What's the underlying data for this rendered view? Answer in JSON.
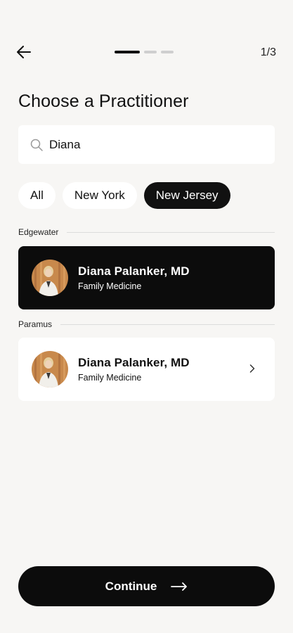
{
  "header": {
    "step_counter": "1/3",
    "progress": {
      "current_step": 1,
      "total_steps": 3
    }
  },
  "page_title": "Choose a Practitioner",
  "search": {
    "value": "Diana",
    "placeholder": ""
  },
  "filters": [
    {
      "label": "All",
      "selected": false
    },
    {
      "label": "New York",
      "selected": false
    },
    {
      "label": "New Jersey",
      "selected": true
    }
  ],
  "sections": [
    {
      "location": "Edgewater",
      "practitioners": [
        {
          "name": "Diana Palanker, MD",
          "specialty": "Family Medicine",
          "selected": true
        }
      ]
    },
    {
      "location": "Paramus",
      "practitioners": [
        {
          "name": "Diana Palanker, MD",
          "specialty": "Family Medicine",
          "selected": false
        }
      ]
    }
  ],
  "continue_button": {
    "label": "Continue",
    "icon": "arrow-right-icon"
  },
  "icons": {
    "back": "arrow-left-icon",
    "search": "search-icon",
    "chevron": "chevron-right-icon"
  },
  "colors": {
    "background": "#f7f6f4",
    "surface": "#ffffff",
    "accent": "#0c0c0c",
    "text": "#111111"
  }
}
